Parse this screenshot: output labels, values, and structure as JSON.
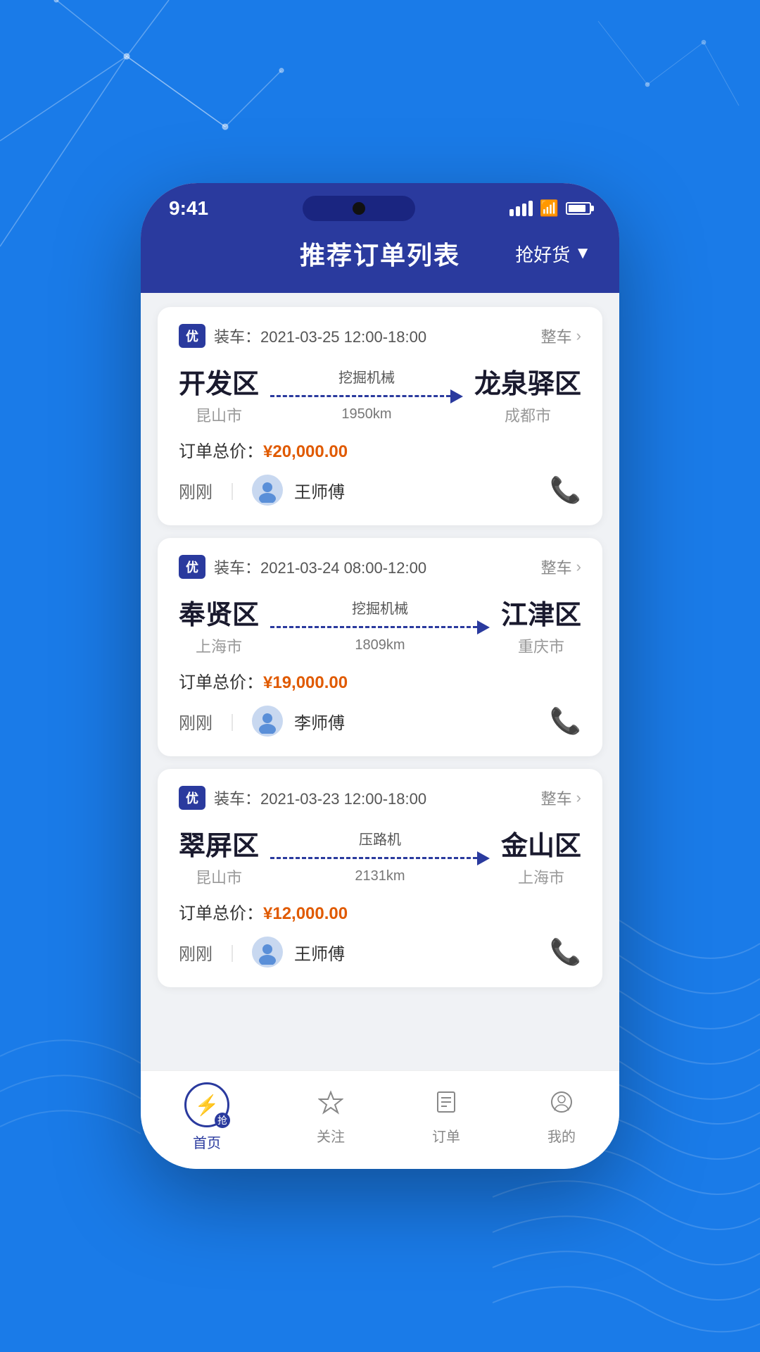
{
  "background": {
    "color": "#1a7be8"
  },
  "status_bar": {
    "time": "9:41"
  },
  "header": {
    "title": "推荐订单列表",
    "filter_label": "抢好货"
  },
  "orders": [
    {
      "badge": "优",
      "load_time": "装车：2021-03-25 12:00-18:00",
      "type_label": "整车",
      "origin_city": "开发区",
      "origin_sub": "昆山市",
      "cargo": "挖掘机械",
      "distance": "1950km",
      "dest_city": "龙泉驿区",
      "dest_sub": "成都市",
      "price_label": "订单总价：",
      "price": "¥20,000.00",
      "time_ago": "刚刚",
      "driver_name": "王师傅"
    },
    {
      "badge": "优",
      "load_time": "装车：2021-03-24 08:00-12:00",
      "type_label": "整车",
      "origin_city": "奉贤区",
      "origin_sub": "上海市",
      "cargo": "挖掘机械",
      "distance": "1809km",
      "dest_city": "江津区",
      "dest_sub": "重庆市",
      "price_label": "订单总价：",
      "price": "¥19,000.00",
      "time_ago": "刚刚",
      "driver_name": "李师傅"
    },
    {
      "badge": "优",
      "load_time": "装车：2021-03-23 12:00-18:00",
      "type_label": "整车",
      "origin_city": "翠屏区",
      "origin_sub": "昆山市",
      "cargo": "压路机",
      "distance": "2131km",
      "dest_city": "金山区",
      "dest_sub": "上海市",
      "price_label": "订单总价：",
      "price": "¥12,000.00",
      "time_ago": "刚刚",
      "driver_name": "王师傅"
    }
  ],
  "bottom_nav": [
    {
      "label": "首页",
      "active": true
    },
    {
      "label": "关注",
      "active": false
    },
    {
      "label": "订单",
      "active": false
    },
    {
      "label": "我的",
      "active": false
    }
  ]
}
